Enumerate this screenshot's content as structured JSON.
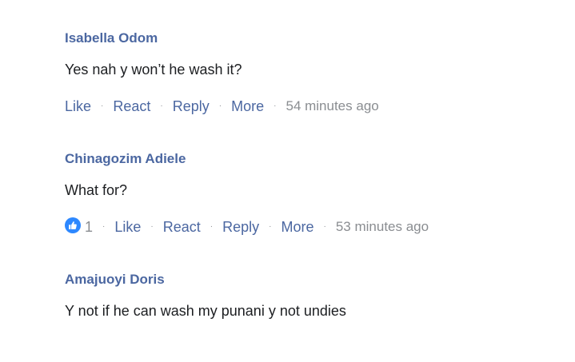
{
  "comments": [
    {
      "author": "Isabella Odom",
      "text": "Yes nah y won’t he wash it?",
      "actions": {
        "like": "Like",
        "react": "React",
        "reply": "Reply",
        "more": "More",
        "separator": "·",
        "time": "54 minutes ago"
      }
    },
    {
      "author": "Chinagozim Adiele",
      "text": "What for?",
      "reaction": {
        "icon": "thumbs-up-icon",
        "count": "1",
        "color": "#2d88ff"
      },
      "actions": {
        "like": "Like",
        "react": "React",
        "reply": "Reply",
        "more": "More",
        "separator": "·",
        "time": "53 minutes ago"
      }
    },
    {
      "author": "Amajuoyi Doris",
      "text": "Y not if he can wash my punani y not undies"
    }
  ],
  "colors": {
    "author": "#4b67a1",
    "link": "#4b67a1",
    "body_text": "#1c1e21",
    "muted": "#8a8d91",
    "like_badge": "#2d88ff"
  }
}
